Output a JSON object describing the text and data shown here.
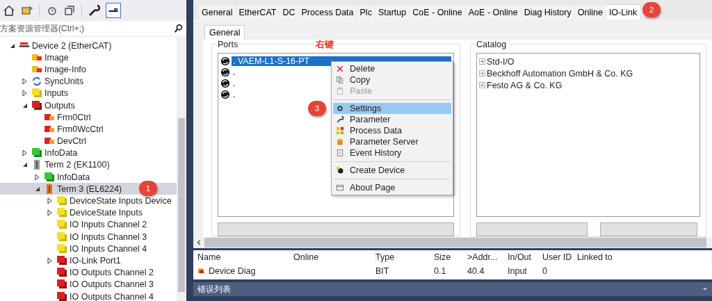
{
  "search": {
    "placeholder": "方案资源管理器(Ctrl+;)"
  },
  "tree": [
    {
      "label": "Device 2 (EtherCAT)",
      "kind": "device",
      "expanded": true,
      "selected": false,
      "children": [
        {
          "label": "Image",
          "kind": "image",
          "selected": false
        },
        {
          "label": "Image-Info",
          "kind": "image",
          "selected": false
        },
        {
          "label": "SyncUnits",
          "kind": "sync",
          "expanded": false,
          "selected": false
        },
        {
          "label": "Inputs",
          "kind": "inputs",
          "expanded": false,
          "selected": false
        },
        {
          "label": "Outputs",
          "kind": "outputs",
          "expanded": true,
          "selected": false,
          "children": [
            {
              "label": "Frm0Ctrl",
              "kind": "outvar",
              "selected": false
            },
            {
              "label": "Frm0WcCtrl",
              "kind": "outvar",
              "selected": false
            },
            {
              "label": "DevCtrl",
              "kind": "outvar",
              "selected": false
            }
          ]
        },
        {
          "label": "InfoData",
          "kind": "info",
          "expanded": false,
          "selected": false
        },
        {
          "label": "Term 2 (EK1100)",
          "kind": "coupler",
          "expanded": true,
          "selected": false,
          "children": [
            {
              "label": "InfoData",
              "kind": "info",
              "expanded": false,
              "selected": false
            },
            {
              "label": "Term 3 (EL6224)",
              "kind": "terminal",
              "expanded": true,
              "selected": true,
              "badge": "1",
              "children": [
                {
                  "label": "DeviceState Inputs Device",
                  "kind": "inputs",
                  "expanded": false,
                  "selected": false
                },
                {
                  "label": "DeviceState Inputs",
                  "kind": "inputs",
                  "expanded": false,
                  "selected": false
                },
                {
                  "label": "IO Inputs Channel 2",
                  "kind": "inputs",
                  "selected": false
                },
                {
                  "label": "IO Inputs Channel 3",
                  "kind": "inputs",
                  "selected": false
                },
                {
                  "label": "IO Inputs Channel 4",
                  "kind": "inputs",
                  "selected": false
                },
                {
                  "label": "IO-Link Port1",
                  "kind": "outputs",
                  "expanded": false,
                  "selected": false
                },
                {
                  "label": "IO Outputs Channel 2",
                  "kind": "outputs",
                  "selected": false
                },
                {
                  "label": "IO Outputs Channel 3",
                  "kind": "outputs",
                  "selected": false
                },
                {
                  "label": "IO Outputs Channel 4",
                  "kind": "outputs",
                  "selected": false
                }
              ]
            }
          ]
        }
      ]
    }
  ],
  "tabs": [
    {
      "label": "General",
      "selected": false
    },
    {
      "label": "EtherCAT",
      "selected": false
    },
    {
      "label": "DC",
      "selected": false
    },
    {
      "label": "Process Data",
      "selected": false
    },
    {
      "label": "Plc",
      "selected": false
    },
    {
      "label": "Startup",
      "selected": false
    },
    {
      "label": "CoE - Online",
      "selected": false
    },
    {
      "label": "AoE - Online",
      "selected": false
    },
    {
      "label": "Diag History",
      "selected": false
    },
    {
      "label": "Online",
      "selected": false
    },
    {
      "label": "IO-Link",
      "selected": true,
      "badge": "2"
    }
  ],
  "subtabs": [
    {
      "label": "General",
      "selected": true
    }
  ],
  "ports": {
    "title": "Ports",
    "note": "右键",
    "items": [
      {
        "label": ". VAEM-L1-S-16-PT",
        "selected": true
      },
      {
        "label": ".",
        "selected": false
      },
      {
        "label": ".",
        "selected": false
      },
      {
        "label": ".",
        "selected": false
      }
    ]
  },
  "context_menu": [
    {
      "kind": "item",
      "label": "Delete",
      "disabled": false,
      "selected": false
    },
    {
      "kind": "item",
      "label": "Copy",
      "disabled": false,
      "selected": false
    },
    {
      "kind": "item",
      "label": "Paste",
      "disabled": true,
      "selected": false
    },
    {
      "kind": "separator"
    },
    {
      "kind": "item",
      "label": "Settings",
      "disabled": false,
      "selected": true,
      "badge": "3"
    },
    {
      "kind": "item",
      "label": "Parameter",
      "disabled": false,
      "selected": false
    },
    {
      "kind": "item",
      "label": "Process Data",
      "disabled": false,
      "selected": false
    },
    {
      "kind": "item",
      "label": "Parameter Server",
      "disabled": false,
      "selected": false
    },
    {
      "kind": "item",
      "label": "Event History",
      "disabled": false,
      "selected": false
    },
    {
      "kind": "separator"
    },
    {
      "kind": "item",
      "label": "Create Device",
      "disabled": false,
      "selected": false
    },
    {
      "kind": "separator"
    },
    {
      "kind": "item",
      "label": "About Page",
      "disabled": false,
      "selected": false
    }
  ],
  "catalog": {
    "title": "Catalog",
    "items": [
      {
        "label": "Std-I/O",
        "expanded": false
      },
      {
        "label": "Beckhoff Automation GmbH & Co. KG",
        "expanded": false
      },
      {
        "label": "Festo AG & Co. KG",
        "expanded": false
      }
    ]
  },
  "grid": {
    "columns": [
      "Name",
      "Online",
      "Type",
      "Size",
      ">Addr...",
      "In/Out",
      "User ID",
      "Linked to"
    ],
    "rows": [
      [
        "Device Diag",
        "",
        "BIT",
        "0.1",
        "40.4",
        "Input",
        "0",
        ""
      ]
    ]
  },
  "bottom_panel": {
    "title": "错误列表"
  }
}
